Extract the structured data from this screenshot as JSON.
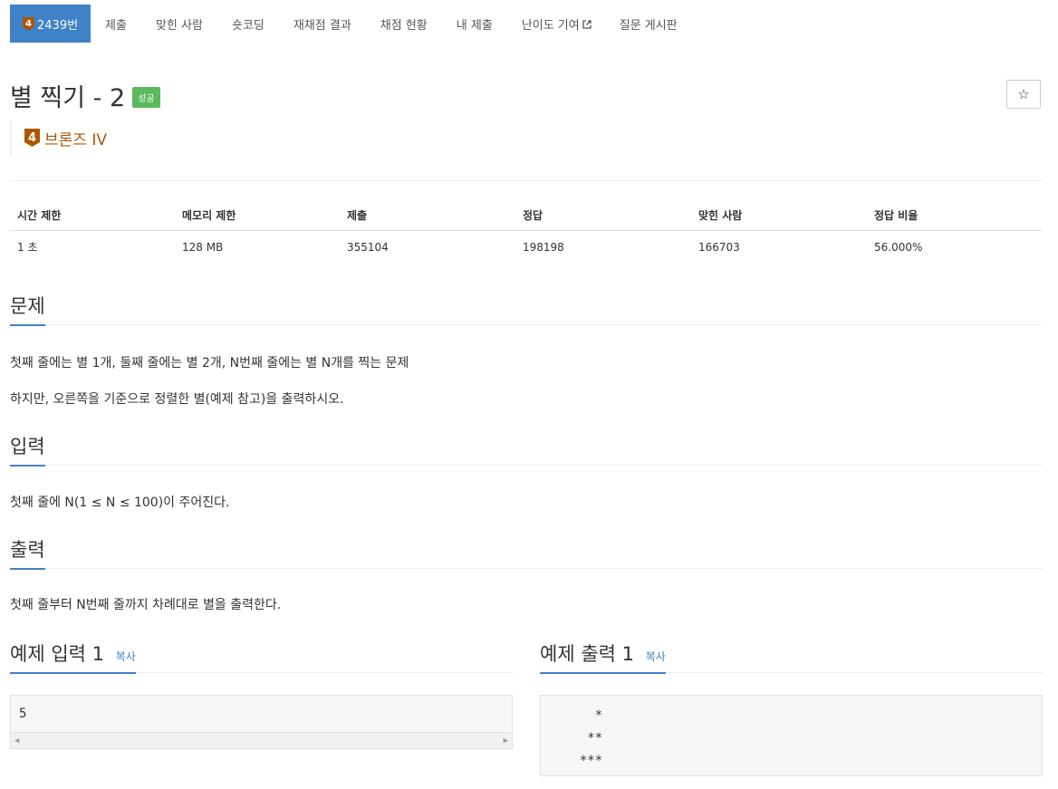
{
  "nav": {
    "problem_number": "2439번",
    "tier_digit": "4",
    "items": [
      "제출",
      "맞힌 사람",
      "숏코딩",
      "재채점 결과",
      "채점 현황",
      "내 제출",
      "난이도 기여",
      "질문 게시판"
    ]
  },
  "problem": {
    "title": "별 찍기 - 2",
    "status_badge": "성공",
    "star_symbol": "☆",
    "tier_digit": "4",
    "tier_label": "브론즈 IV",
    "tier_color": "#ad5600"
  },
  "info_table": {
    "headers": [
      "시간 제한",
      "메모리 제한",
      "제출",
      "정답",
      "맞힌 사람",
      "정답 비율"
    ],
    "values": [
      "1 초",
      "128 MB",
      "355104",
      "198198",
      "166703",
      "56.000%"
    ]
  },
  "sections": {
    "problem": {
      "heading": "문제",
      "lines": [
        "첫째 줄에는 별 1개, 둘째 줄에는 별 2개, N번째 줄에는 별 N개를 찍는 문제",
        "하지만, 오른쪽을 기준으로 정렬한 별(예제 참고)을 출력하시오."
      ]
    },
    "input": {
      "heading": "입력",
      "text": "첫째 줄에 N(1 ≤ N ≤ 100)이 주어진다."
    },
    "output": {
      "heading": "출력",
      "text": "첫째 줄부터 N번째 줄까지 차례대로 별을 출력한다."
    }
  },
  "samples": {
    "input": {
      "heading": "예제 입력 1",
      "copy": "복사",
      "content": "5"
    },
    "output": {
      "heading": "예제 출력 1",
      "copy": "복사",
      "lines": [
        "    *",
        "   **",
        "  ***"
      ]
    }
  },
  "colors": {
    "accent": "#3f82c8",
    "success": "#5cb85c"
  }
}
